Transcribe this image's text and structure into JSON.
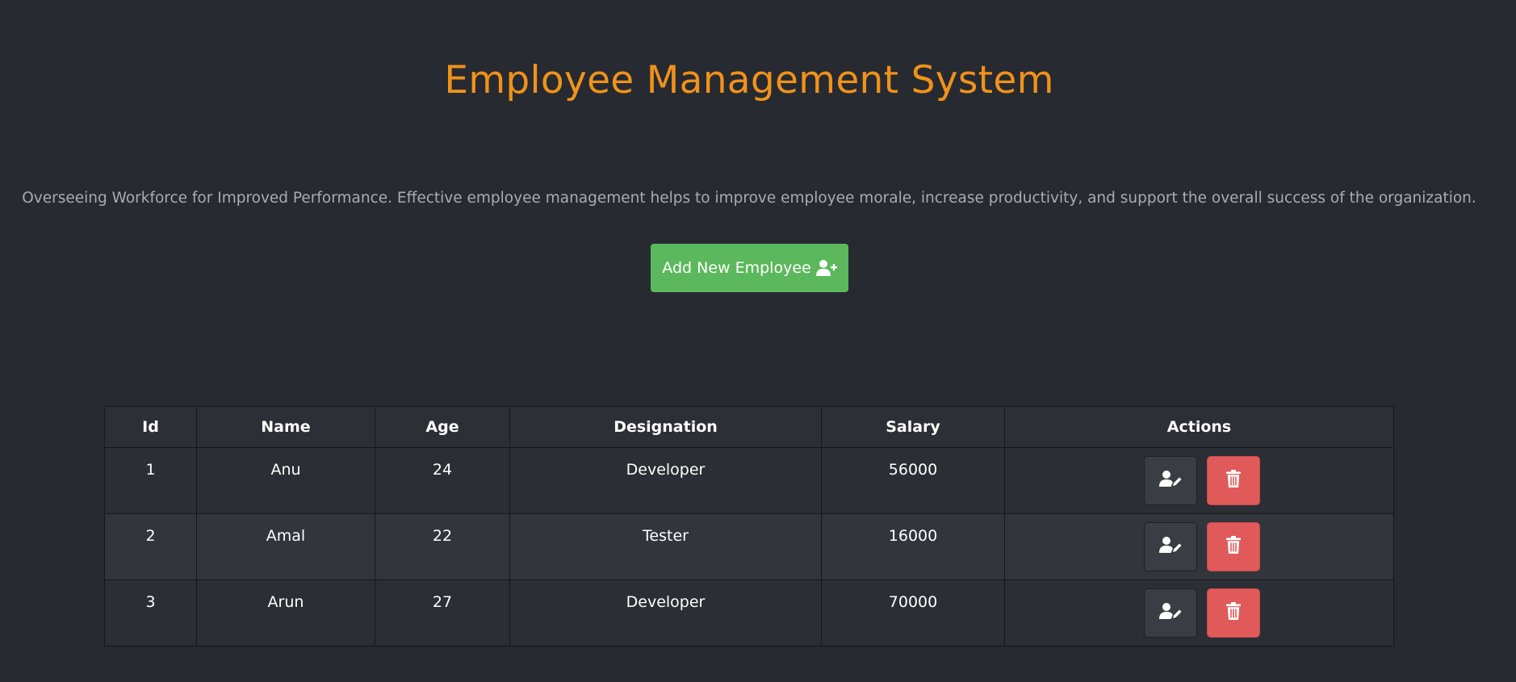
{
  "header": {
    "title": "Employee Management System",
    "subtitle": "Overseeing Workforce for Improved Performance. Effective employee management helps to improve employee morale, increase productivity, and support the overall success of the organization."
  },
  "add_button": {
    "label": "Add New Employee",
    "icon": "user-plus-icon"
  },
  "table": {
    "columns": [
      "Id",
      "Name",
      "Age",
      "Designation",
      "Salary",
      "Actions"
    ],
    "rows": [
      {
        "id": "1",
        "name": "Anu",
        "age": "24",
        "designation": "Developer",
        "salary": "56000"
      },
      {
        "id": "2",
        "name": "Amal",
        "age": "22",
        "designation": "Tester",
        "salary": "16000"
      },
      {
        "id": "3",
        "name": "Arun",
        "age": "27",
        "designation": "Developer",
        "salary": "70000"
      }
    ],
    "actions": {
      "edit_icon": "user-edit-icon",
      "delete_icon": "trash-icon"
    }
  },
  "colors": {
    "background": "#272a30",
    "title": "#f0921a",
    "add_button": "#5cb85c",
    "delete_button": "#e05a5a",
    "edit_button": "#3a3d43"
  }
}
